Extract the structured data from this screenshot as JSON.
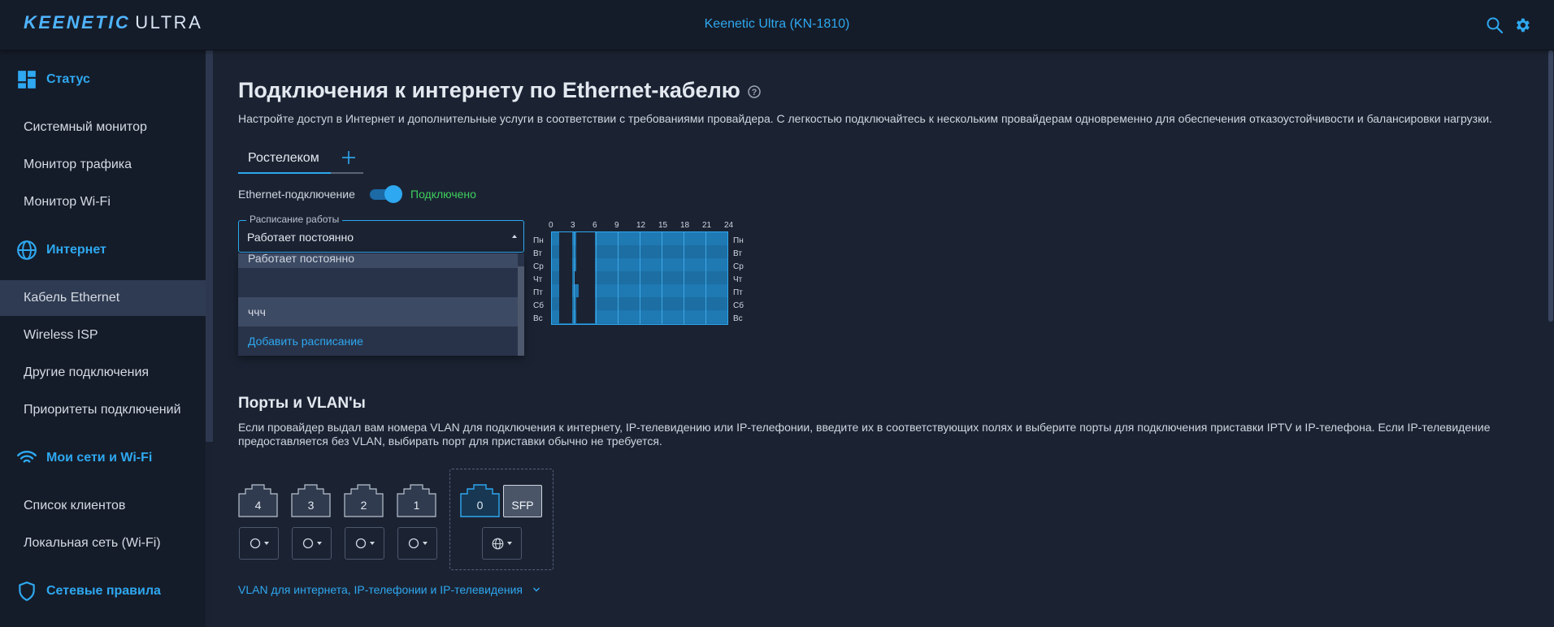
{
  "header": {
    "logo_bold": "KEENETIC",
    "logo_thin": "ULTRA",
    "device_title": "Keenetic Ultra (KN-1810)",
    "icons": [
      "search-icon",
      "gear-icon"
    ]
  },
  "sidebar": {
    "sections": {
      "status": "Статус",
      "internet": "Интернет",
      "networks": "Мои сети и Wi-Fi",
      "rules": "Сетевые правила"
    },
    "items": {
      "system_monitor": "Системный монитор",
      "traffic_monitor": "Монитор трафика",
      "wifi_monitor": "Монитор Wi-Fi",
      "ethernet_cable": "Кабель Ethernet",
      "wireless_isp": "Wireless ISP",
      "other_connections": "Другие подключения",
      "connection_priorities": "Приоритеты подключений",
      "client_list": "Список клиентов",
      "local_network": "Локальная сеть (Wi-Fi)"
    },
    "active": "Кабель Ethernet"
  },
  "main": {
    "title": "Подключения к интернету по Ethernet-кабелю",
    "description": "Настройте доступ в Интернет и дополнительные услуги в соответствии с требованиями провайдера. С легкостью подключайтесь к нескольким провайдерам одновременно для обеспечения отказоустойчивости и балансировки нагрузки.",
    "tabs": [
      {
        "label": "Ростелеком"
      }
    ],
    "ethernet_label": "Ethernet-подключение",
    "ethernet_status": "Подключено",
    "ethernet_enabled": true,
    "schedule": {
      "legend": "Расписание работы",
      "value": "Работает постоянно",
      "options": [
        "Работает постоянно",
        "",
        "ччч",
        "Добавить расписание"
      ]
    },
    "schedule_grid": {
      "hours": [
        "0",
        "3",
        "6",
        "9",
        "12",
        "15",
        "18",
        "21",
        "24"
      ],
      "days": [
        "Пн",
        "Вт",
        "Ср",
        "Чт",
        "Пт",
        "Сб",
        "Вс"
      ]
    }
  },
  "ports_section": {
    "title": "Порты и VLAN'ы",
    "description": "Если провайдер выдал вам номера VLAN для подключения к интернету, IP-телевидению или IP-телефонии, введите их в соответствующих полях и выберите порты для подключения приставки IPTV и IP-телефона. Если IP-телевидение предоставляется без VLAN, выбирать порт для приставки обычно не требуется.",
    "ports": [
      "4",
      "3",
      "2",
      "1"
    ],
    "wan_port": "0",
    "sfp": "SFP",
    "vlan_link": "VLAN для интернета, IP-телефонии и IP-телевидения"
  },
  "colors": {
    "accent": "#2ea8f0",
    "success": "#3ecf5c",
    "background": "#1b2333",
    "sidebar": "#151c29"
  }
}
